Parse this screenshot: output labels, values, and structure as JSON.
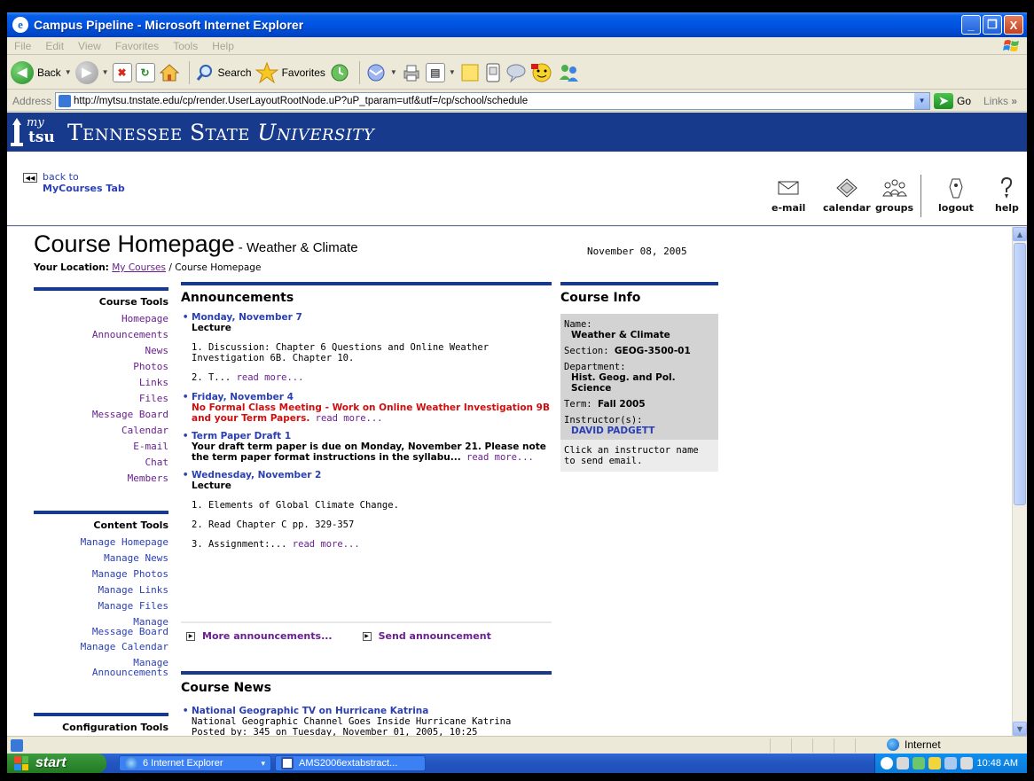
{
  "window": {
    "title": "Campus Pipeline - Microsoft Internet Explorer",
    "ie_glyph": "e",
    "buttons": {
      "minimize": "_",
      "maximize": "❐",
      "close": "X"
    }
  },
  "menu": [
    "File",
    "Edit",
    "View",
    "Favorites",
    "Tools",
    "Help"
  ],
  "toolbar": {
    "back_label": "Back",
    "search_label": "Search",
    "favorites_label": "Favorites",
    "icons": [
      "back-icon",
      "forward-icon",
      "stop-icon",
      "refresh-icon",
      "home-icon",
      "search-icon",
      "favorites-star-icon",
      "history-icon",
      "mail-icon",
      "print-icon",
      "edit-icon",
      "discuss-icon",
      "messenger-icon",
      "research-icon",
      "buddy-icon"
    ]
  },
  "address": {
    "label": "Address",
    "url": "http://mytsu.tnstate.edu/cp/render.UserLayoutRootNode.uP?uP_tparam=utf&utf=/cp/school/schedule",
    "go_label": "Go",
    "links_label": "Links",
    "links_chevron": "»"
  },
  "banner": {
    "logo_text": "my",
    "logo_sub": "tsu",
    "uni_part1": "Tennessee State ",
    "uni_part2": "University"
  },
  "nav": {
    "back_line1": "back to",
    "back_line2": "MyCourses Tab",
    "icons": [
      {
        "label": "e-mail",
        "icon": "envelope-icon"
      },
      {
        "label": "calendar",
        "icon": "calendar-icon"
      },
      {
        "label": "groups",
        "icon": "groups-icon"
      },
      {
        "label": "logout",
        "icon": "logout-icon"
      },
      {
        "label": "help",
        "icon": "help-icon"
      }
    ]
  },
  "page": {
    "title": "Course Homepage",
    "course_name": " - Weather & Climate",
    "location_label": "Your Location:",
    "location_link": "My Courses",
    "location_current": " / Course Homepage",
    "date": "November 08, 2005"
  },
  "course_tools": {
    "heading": "Course Tools",
    "items": [
      "Homepage",
      "Announcements",
      "News",
      "Photos",
      "Links",
      "Files",
      "Message Board",
      "Calendar",
      "E-mail",
      "Chat",
      "Members"
    ]
  },
  "content_tools": {
    "heading": "Content Tools",
    "items": [
      "Manage Homepage",
      "Manage News",
      "Manage Photos",
      "Manage Links",
      "Manage Files",
      "Manage\nMessage Board",
      "Manage Calendar",
      "Manage\nAnnouncements"
    ]
  },
  "config_tools": {
    "heading": "Configuration Tools"
  },
  "announcements": {
    "heading": "Announcements",
    "items": [
      {
        "date": "Monday, November 7",
        "subtitle": "Lecture",
        "p1": "1. Discussion: Chapter 6 Questions and Online Weather Investigation 6B. Chapter 10.",
        "p2": "2. T... ",
        "more": "read more..."
      },
      {
        "date": "Friday, November 4",
        "red_text": "No Formal Class Meeting - Work on Online Weather Investigation 9B and your Term Papers.",
        "more": " read more..."
      },
      {
        "date": "Term Paper Draft 1",
        "bold_text": "Your draft term paper is due on Monday, November 21. Please note the term paper format instructions in the syllabu...",
        "more": " read more..."
      },
      {
        "date": "Wednesday, November 2",
        "subtitle": "Lecture",
        "p1": "1. Elements of Global Climate Change.",
        "p2": "2. Read Chapter C pp. 329-357",
        "p3": "3. Assignment:... ",
        "more": "read more..."
      }
    ],
    "more_link": "More announcements...",
    "send_link": "Send announcement"
  },
  "news": {
    "heading": "Course News",
    "item_title": "National Geographic TV on Hurricane Katrina",
    "item_text": "National Geographic Channel Goes Inside Hurricane Katrina",
    "item_cut": "Posted by: 345 on Tuesday, November 01, 2005, 10:25"
  },
  "course_info": {
    "heading": "Course Info",
    "name_label": "Name:",
    "name_value": "Weather & Climate",
    "section_label": "Section: ",
    "section_value": "GEOG-3500-01",
    "dept_label": "Department:",
    "dept_value": "Hist. Geog. and Pol. Science",
    "term_label": "Term: ",
    "term_value": "Fall 2005",
    "instructor_label": "Instructor(s):",
    "instructor_value": "DAVID PADGETT",
    "note": "Click an instructor name to send email."
  },
  "status": {
    "zone": "Internet"
  },
  "taskbar": {
    "start": "start",
    "task1": "6 Internet Explorer",
    "task1_arrow": "▾",
    "task2": "AMS2006extabstract...",
    "clock": "10:48 AM"
  },
  "colors": {
    "banner": "#173a8c",
    "link_purple": "#6a1f91",
    "link_blue": "#2a3fb5",
    "alert_red": "#d10d0d"
  }
}
